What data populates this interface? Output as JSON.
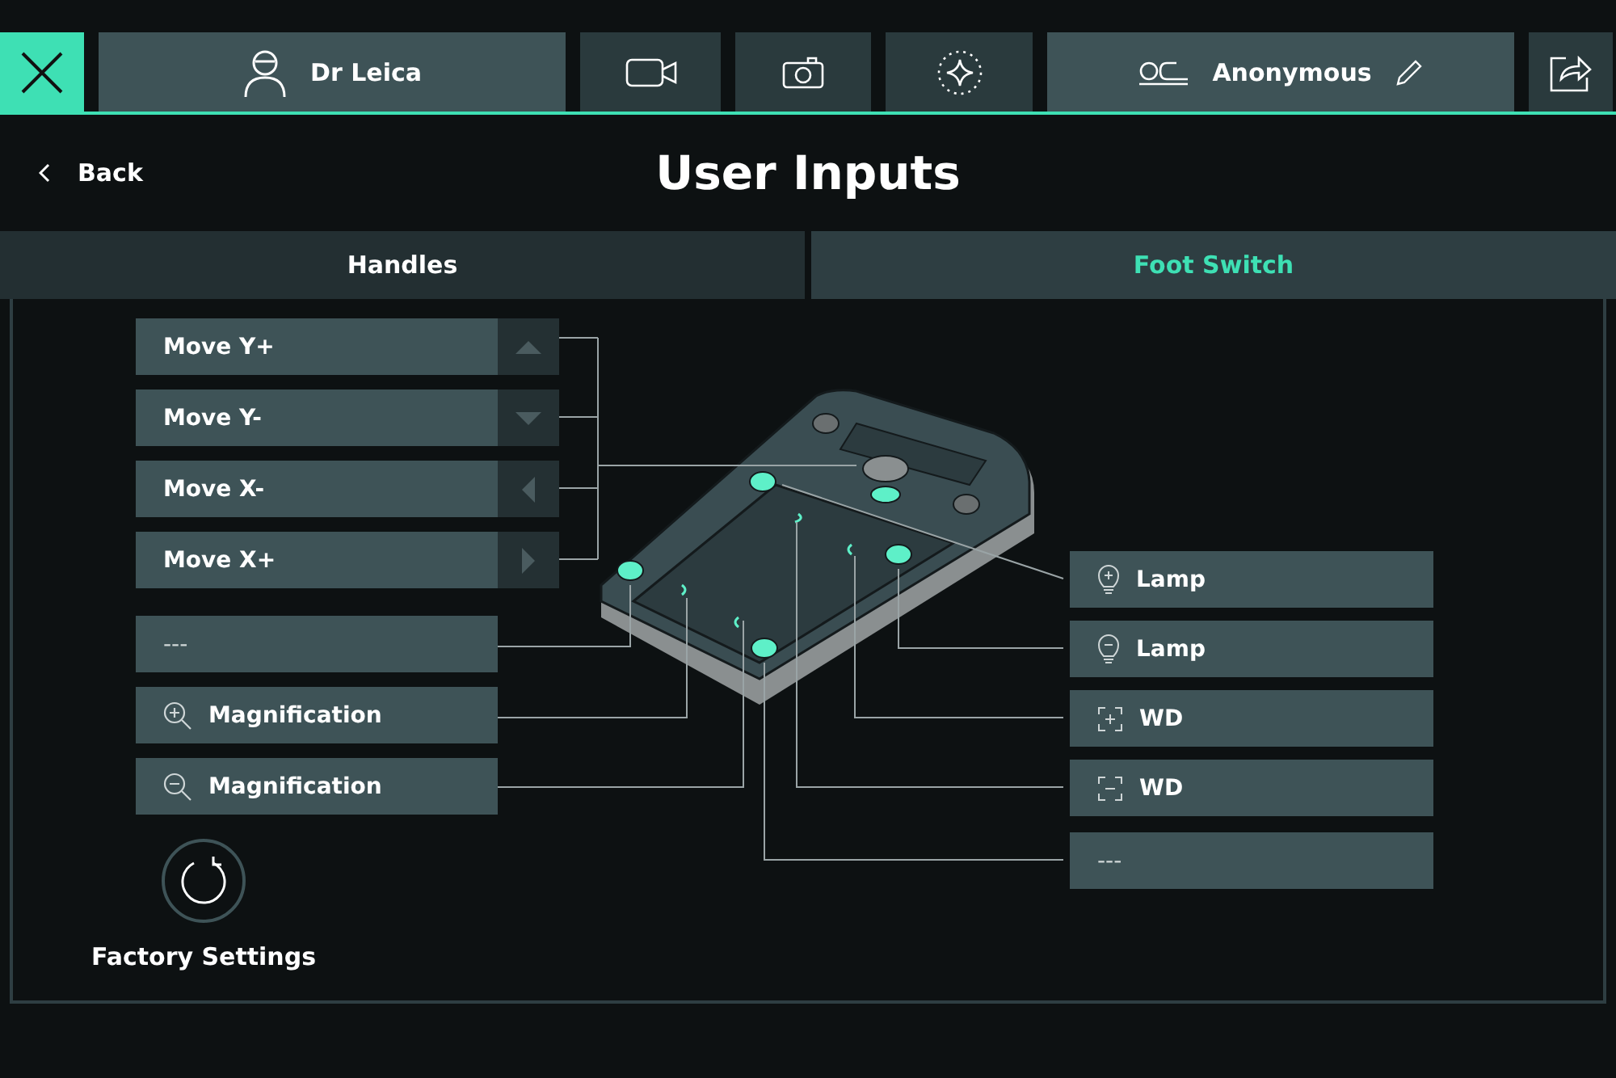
{
  "header": {
    "user": "Dr Leica",
    "patient": "Anonymous"
  },
  "nav": {
    "back": "Back",
    "title": "User Inputs"
  },
  "tabs": [
    {
      "label": "Handles",
      "selected": false
    },
    {
      "label": "Foot Switch",
      "selected": true
    }
  ],
  "left_inputs": [
    {
      "label": "Move Y+",
      "kind": "up"
    },
    {
      "label": "Move Y-",
      "kind": "down"
    },
    {
      "label": "Move X-",
      "kind": "left"
    },
    {
      "label": "Move X+",
      "kind": "right"
    },
    {
      "label": "---",
      "kind": "none"
    },
    {
      "label": "Magnification",
      "kind": "zoom-in"
    },
    {
      "label": "Magnification",
      "kind": "zoom-out"
    }
  ],
  "right_inputs": [
    {
      "label": "Lamp",
      "kind": "lamp-plus"
    },
    {
      "label": "Lamp",
      "kind": "lamp-minus"
    },
    {
      "label": "WD",
      "kind": "wd-plus"
    },
    {
      "label": "WD",
      "kind": "wd-minus"
    },
    {
      "label": "---",
      "kind": "none"
    }
  ],
  "factory_settings": {
    "label": "Factory Settings"
  }
}
